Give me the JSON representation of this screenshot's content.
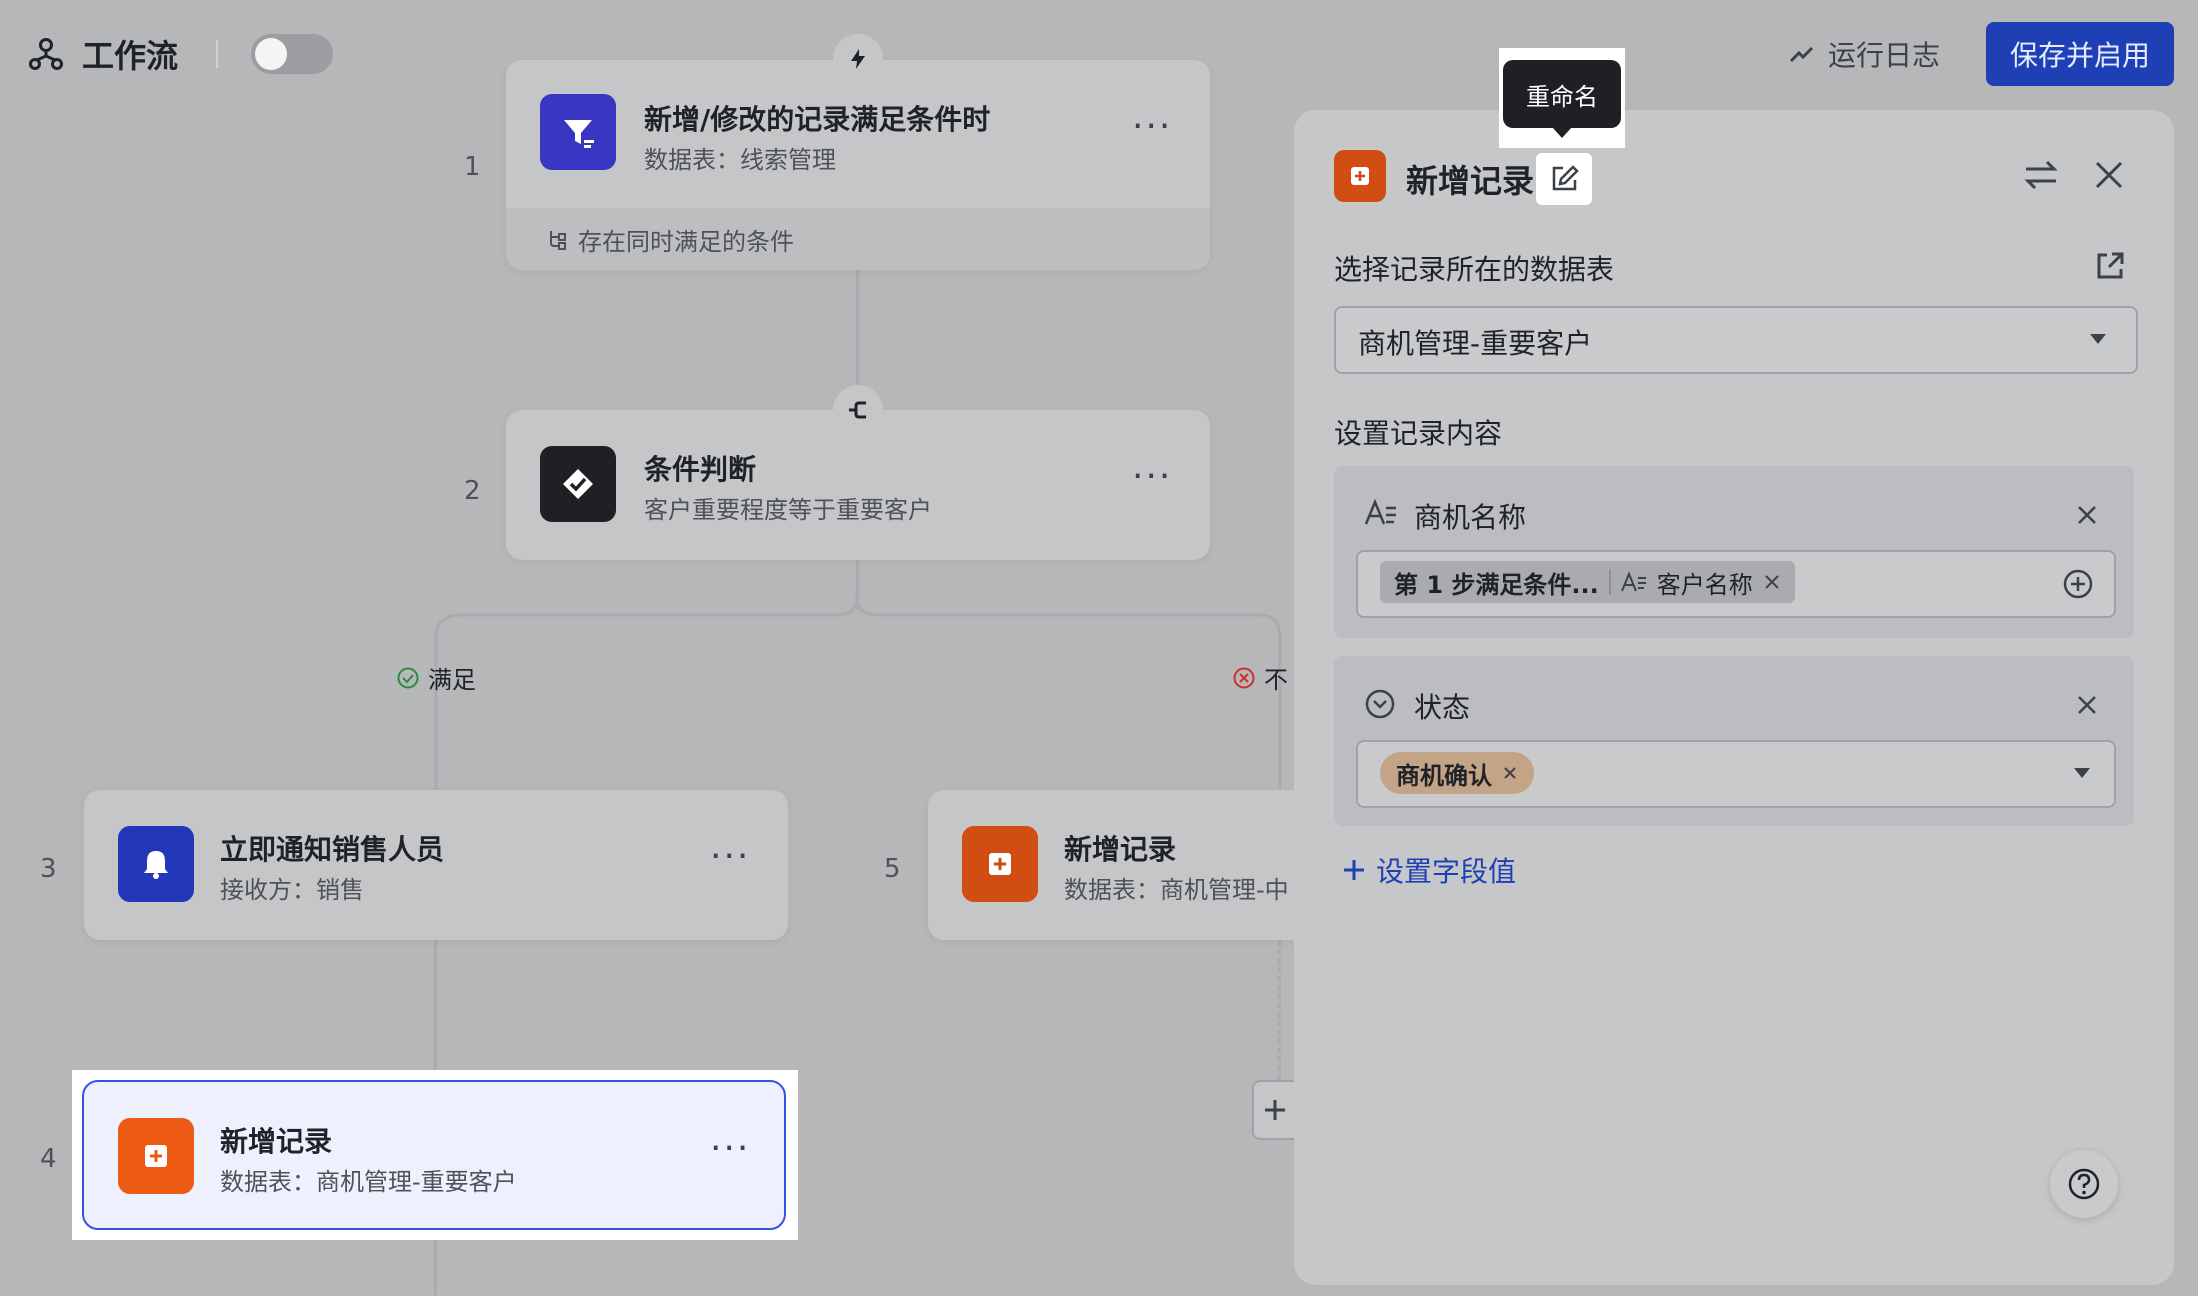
{
  "header": {
    "title": "工作流",
    "run_log": "运行日志",
    "save_button": "保存并启用"
  },
  "nodes": [
    {
      "step": "1",
      "title": "新增/修改的记录满足条件时",
      "subtitle": "数据表：线索管理",
      "footer": "存在同时满足的条件"
    },
    {
      "step": "2",
      "title": "条件判断",
      "subtitle": "客户重要程度等于重要客户"
    },
    {
      "step": "3",
      "title": "立即通知销售人员",
      "subtitle": "接收方：销售"
    },
    {
      "step": "4",
      "title": "新增记录",
      "subtitle": "数据表：商机管理-重要客户"
    },
    {
      "step": "5",
      "title": "新增记录",
      "subtitle": "数据表：商机管理-中"
    }
  ],
  "branches": {
    "yes": "满足",
    "no": "不"
  },
  "more_glyph": "···",
  "panel": {
    "title": "新增记录",
    "tooltip": "重命名",
    "table_section_label": "选择记录所在的数据表",
    "selected_table": "商机管理-重要客户",
    "content_section_label": "设置记录内容",
    "fields": [
      {
        "name": "商机名称",
        "chip1": "第 1 步满足条件...",
        "chip2": "客户名称"
      },
      {
        "name": "状态",
        "chip1": "商机确认"
      }
    ],
    "add_field": "设置字段值"
  },
  "colors": {
    "accent": "#1f3fb5",
    "trigger_icon": "#3a36c4",
    "condition_icon": "#1f2024",
    "notify_icon": "#2338b8",
    "record_icon": "#d24d12",
    "selected_outline": "#2f56e0",
    "yes": "#2e8b3e",
    "no": "#d12c2c"
  }
}
